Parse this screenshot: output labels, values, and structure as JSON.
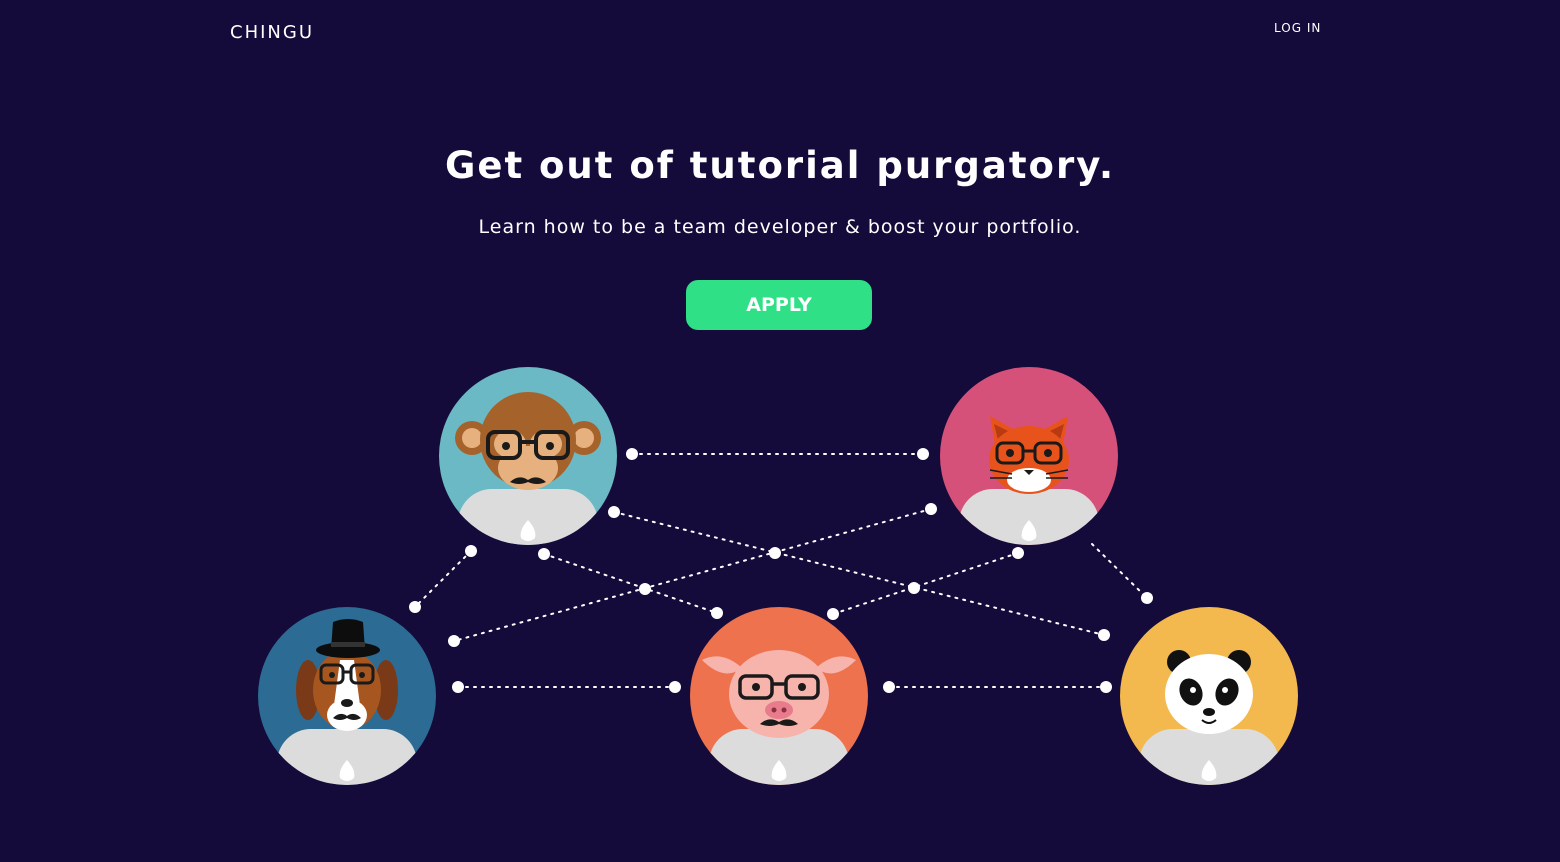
{
  "header": {
    "brand": "CHINGU",
    "login_label": "LOG IN"
  },
  "hero": {
    "headline": "Get out of tutorial purgatory.",
    "subhead": "Learn how to be a team developer & boost your portfolio.",
    "apply_label": "APPLY"
  },
  "colors": {
    "background": "#150b3a",
    "apply_button": "#2fe086",
    "monkey_bg": "#6bb9c5",
    "cat_bg": "#d6517a",
    "dog_bg": "#2c6b93",
    "pig_bg": "#ee724e",
    "panda_bg": "#f3b94e"
  },
  "team_avatars": [
    {
      "name": "monkey-avatar"
    },
    {
      "name": "cat-avatar"
    },
    {
      "name": "dog-avatar"
    },
    {
      "name": "pig-avatar"
    },
    {
      "name": "panda-avatar"
    }
  ]
}
